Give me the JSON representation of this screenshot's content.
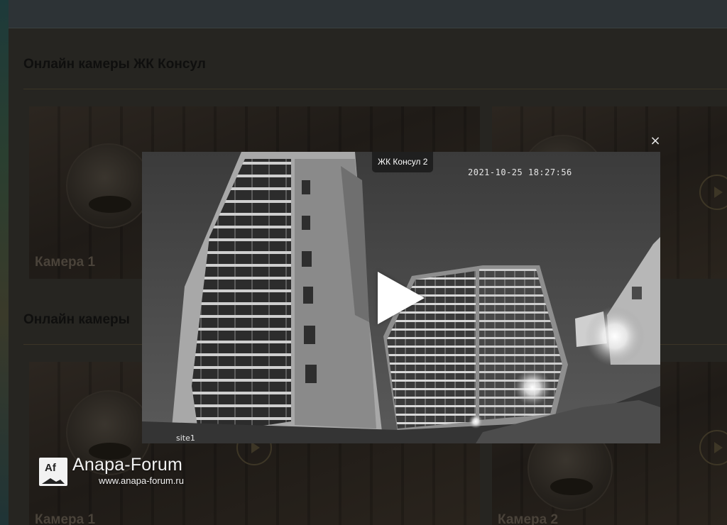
{
  "sections": [
    {
      "title": "Онлайн камеры ЖК Консул"
    },
    {
      "title": "Онлайн камеры"
    }
  ],
  "cameras": {
    "top_left": "Камера 1",
    "bottom_left": "Камера 1",
    "bottom_right": "Камера 2"
  },
  "modal": {
    "title": "ЖК Консул 2",
    "timestamp": "2021-10-25 18:27:56",
    "site_label": "site1",
    "close_symbol": "×",
    "play_icon": "play-icon"
  },
  "watermark": {
    "logo_text": "Af",
    "name": "Anapa-Forum",
    "url": "www.anapa-forum.ru"
  },
  "colors": {
    "overlay_bg": "#262521",
    "title_bar": "#1f1f1f",
    "play": "#ffffff"
  }
}
